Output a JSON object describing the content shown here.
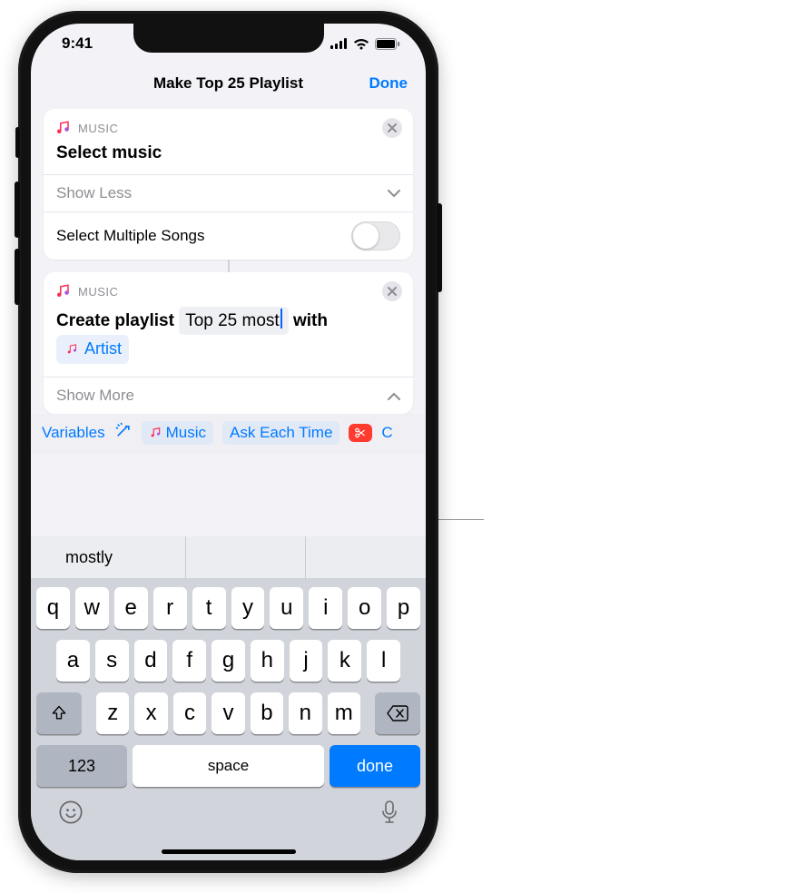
{
  "status": {
    "time": "9:41"
  },
  "nav": {
    "title": "Make Top 25 Playlist",
    "done": "Done"
  },
  "card1": {
    "app": "MUSIC",
    "title": "Select music",
    "show_less": "Show Less",
    "multi": "Select Multiple Songs"
  },
  "card2": {
    "app": "MUSIC",
    "prefix": "Create playlist",
    "name_param": "Top 25 most",
    "mid": "with",
    "token": "Artist",
    "show_more": "Show More"
  },
  "varbar": {
    "label": "Variables",
    "chip_music": "Music",
    "chip_ask": "Ask Each Time",
    "chip_cut_trail": "C"
  },
  "prediction": {
    "s1": "mostly",
    "s2": "",
    "s3": ""
  },
  "keys_r1": [
    "q",
    "w",
    "e",
    "r",
    "t",
    "y",
    "u",
    "i",
    "o",
    "p"
  ],
  "keys_r2": [
    "a",
    "s",
    "d",
    "f",
    "g",
    "h",
    "j",
    "k",
    "l"
  ],
  "keys_r3": [
    "z",
    "x",
    "c",
    "v",
    "b",
    "n",
    "m"
  ],
  "kbd": {
    "num": "123",
    "space": "space",
    "done": "done"
  }
}
